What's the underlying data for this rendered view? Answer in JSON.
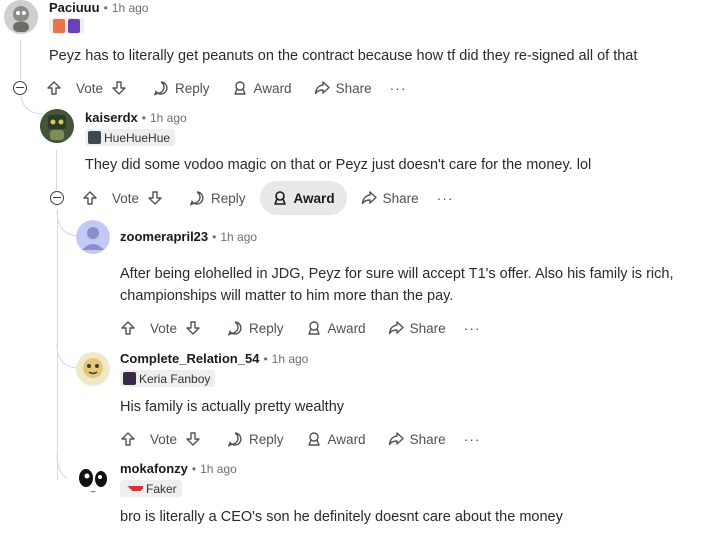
{
  "comments": [
    {
      "username": "Paciuuu",
      "time": "1h ago",
      "text": "Peyz has to literally get peanuts on the contract because how tf did they re-signed all of that",
      "vote": "Vote",
      "reply": "Reply",
      "award": "Award",
      "share": "Share",
      "more": "···"
    },
    {
      "username": "kaiserdx",
      "time": "1h ago",
      "flair": "HueHueHue",
      "text": "They did some vodoo magic on that or Peyz just doesn't care for the money. lol",
      "vote": "Vote",
      "reply": "Reply",
      "award": "Award",
      "share": "Share",
      "more": "···"
    },
    {
      "username": "zoomerapril23",
      "time": "1h ago",
      "text_line1": "After being elohelled in JDG, Peyz for sure will accept T1's offer. Also his family is rich,",
      "text_line2": "championships will matter to him more than the pay.",
      "vote": "Vote",
      "reply": "Reply",
      "award": "Award",
      "share": "Share",
      "more": "···"
    },
    {
      "username": "Complete_Relation_54",
      "time": "1h ago",
      "flair": "Keria Fanboy",
      "text": "His family is actually pretty wealthy",
      "vote": "Vote",
      "reply": "Reply",
      "award": "Award",
      "share": "Share",
      "more": "···"
    },
    {
      "username": "mokafonzy",
      "time": "1h ago",
      "flair": "Faker",
      "text": "bro is literally a CEO's son he definitely doesnt care about the money"
    }
  ],
  "separator": "•",
  "colors": {
    "upvote": "#4b5358",
    "award_active_bg": "#e6e8e9",
    "thread_line": "#d7dadc",
    "faker_flair": "#d8323b"
  }
}
